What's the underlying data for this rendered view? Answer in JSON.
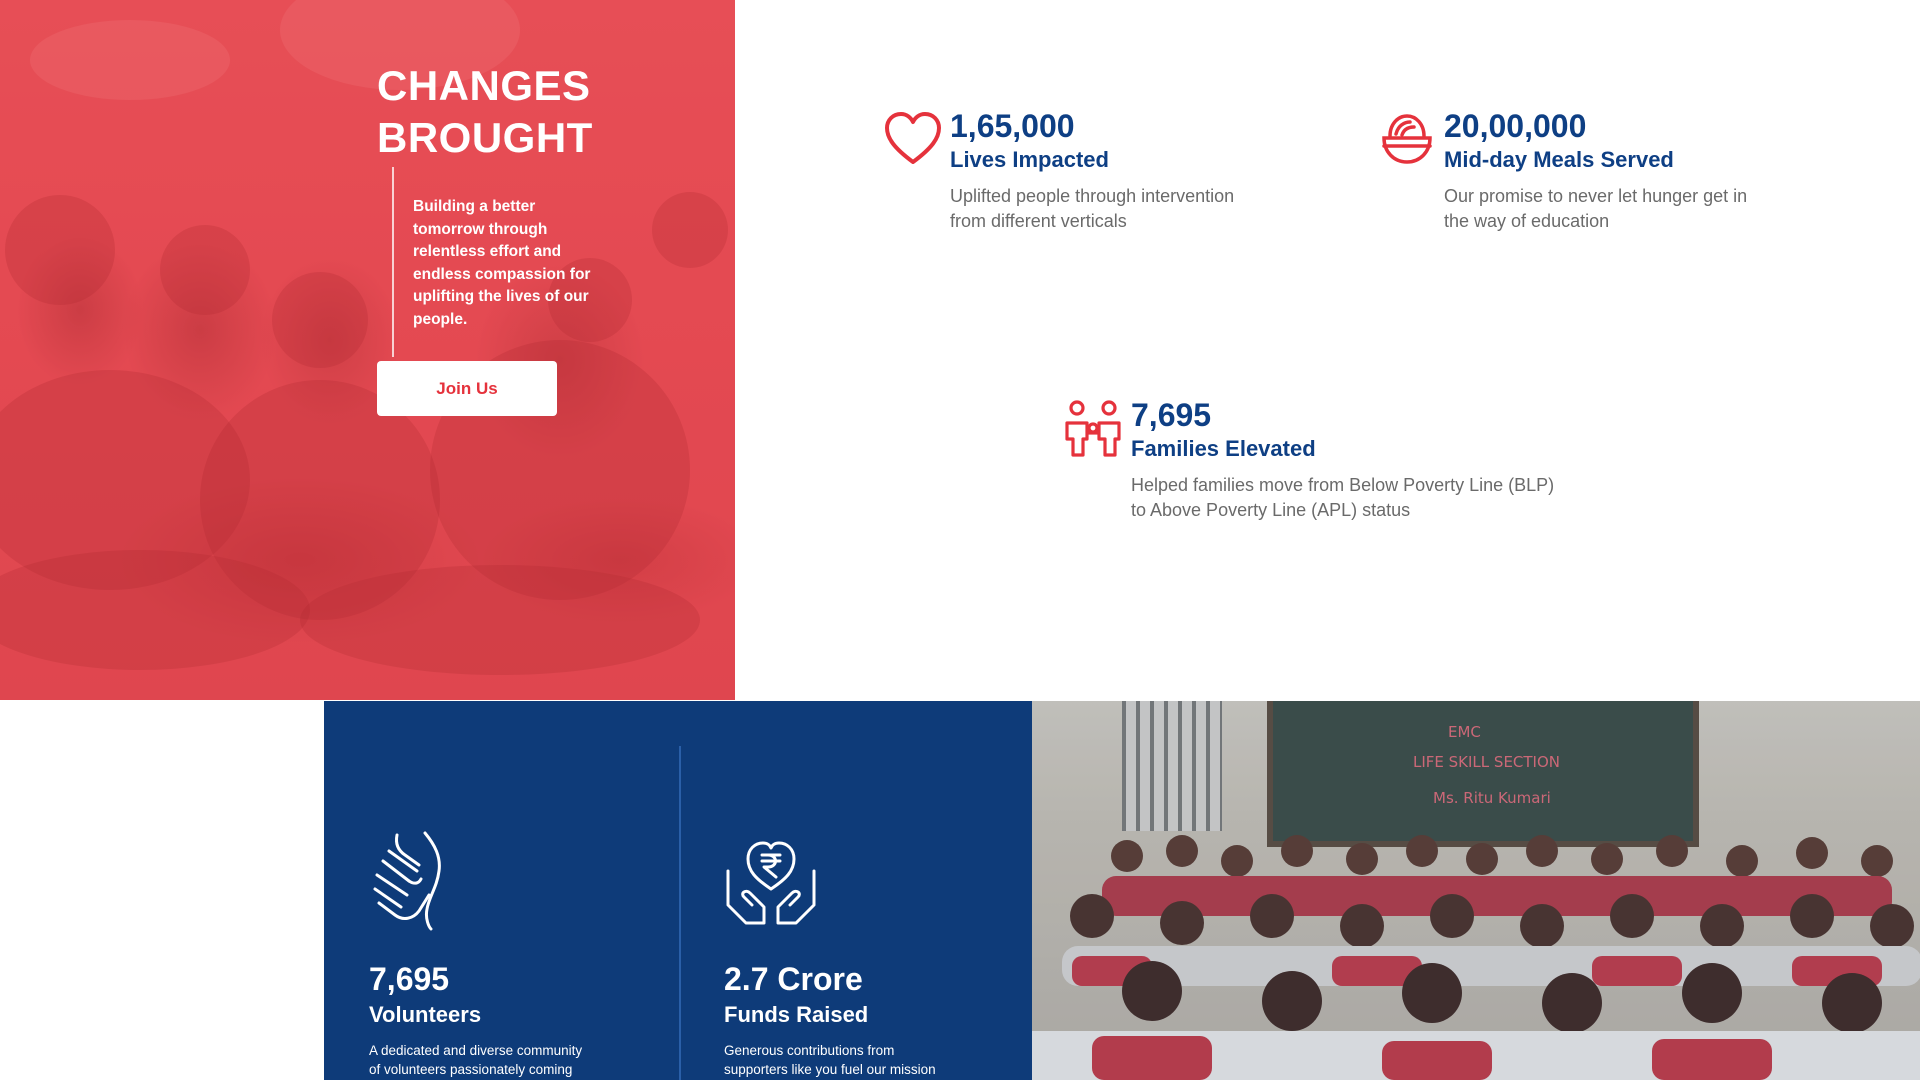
{
  "hero": {
    "title_line1": "CHANGES",
    "title_line2": "BROUGHT",
    "description": "Building a better tomorrow through relentless effort and endless compassion for uplifting the lives of our people.",
    "button_label": "Join Us"
  },
  "stats": [
    {
      "number": "1,65,000",
      "label": "Lives Impacted",
      "description_line1": "Uplifted people through intervention",
      "description_line2": "from different verticals",
      "icon": "heart-icon"
    },
    {
      "number": "20,00,000",
      "label": "Mid-day Meals Served",
      "description_line1": "Our promise to never let hunger get in",
      "description_line2": "the way of education",
      "icon": "meal-bowl-icon"
    },
    {
      "number": "7,695",
      "label": "Families Elevated",
      "description_line1": "Helped families move from Below Poverty Line (BLP)",
      "description_line2": "to Above Poverty Line (APL) status",
      "icon": "family-icon"
    }
  ],
  "bottom_stats": [
    {
      "number": "7,695",
      "label": "Volunteers",
      "description_line1": "A dedicated and diverse community",
      "description_line2": "of volunteers passionately coming",
      "icon": "helping-hands-icon"
    },
    {
      "number": "2.7 Crore",
      "label": "Funds Raised",
      "description_line1": "Generous contributions from",
      "description_line2": "supporters like you fuel our mission",
      "icon": "rupee-heart-hands-icon"
    }
  ],
  "colors": {
    "hero_red": "#e44d55",
    "brand_blue": "#0e3f84",
    "section_blue": "#0e3b79",
    "button_text": "#e5323c",
    "icon_red": "#e5323c"
  }
}
